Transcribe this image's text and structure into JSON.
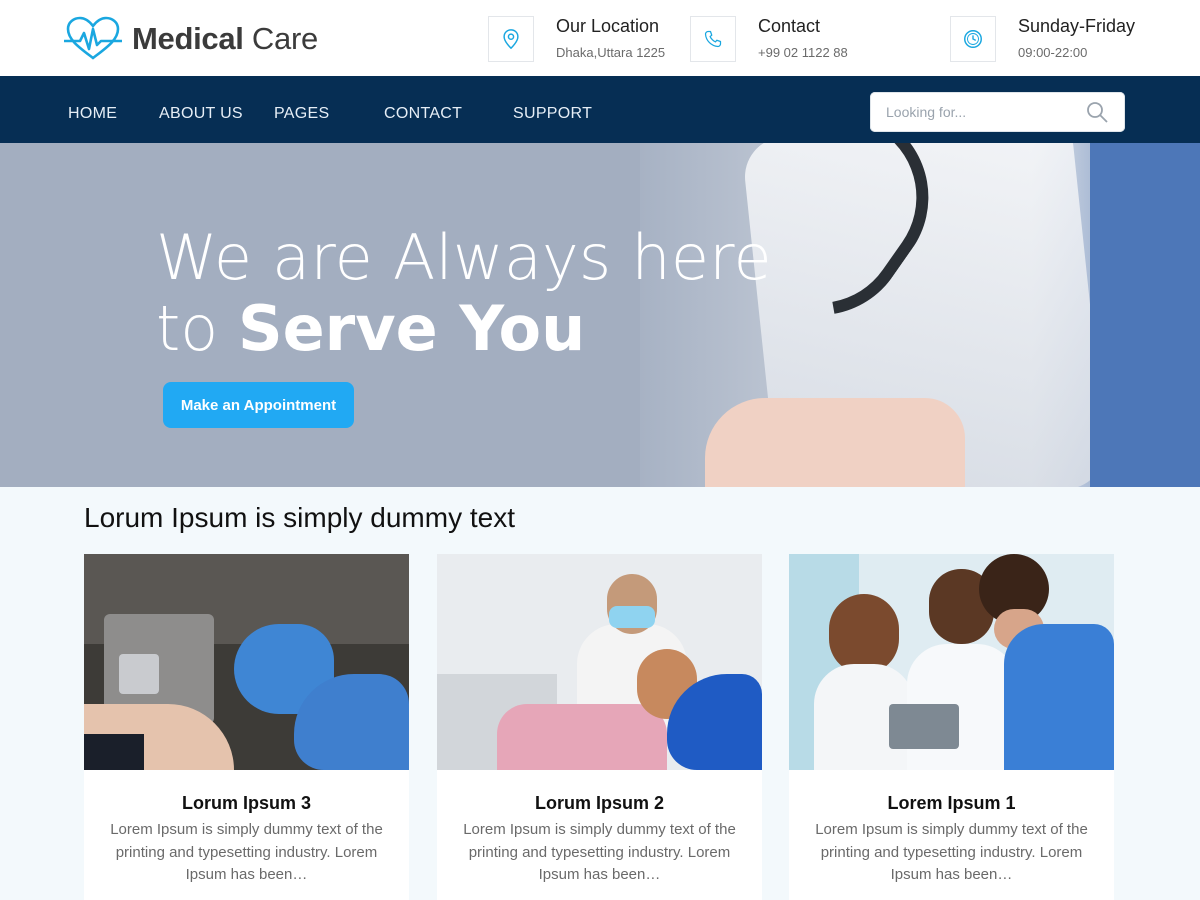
{
  "brand": {
    "name_bold": "Medical",
    "name_light": " Care",
    "logo_color": "#1aa7e0"
  },
  "contact_info": [
    {
      "icon": "location-pin-icon",
      "title": "Our Location",
      "subtitle": "Dhaka,Uttara 1225"
    },
    {
      "icon": "phone-icon",
      "title": "Contact",
      "subtitle": "+99 02 1122 88"
    },
    {
      "icon": "clock-icon",
      "title": "Sunday-Friday",
      "subtitle": "09:00-22:00"
    }
  ],
  "nav": {
    "items": [
      "HOME",
      "ABOUT US",
      "PAGES",
      "CONTACT",
      "SUPPORT"
    ],
    "background": "#062e54"
  },
  "search": {
    "placeholder": "Looking for...",
    "value": "",
    "icon": "search-icon"
  },
  "hero": {
    "line1": "We are Always here",
    "line2_light": "to ",
    "line2_bold": "Serve You",
    "cta": "Make an Appointment",
    "cta_color": "#21a9f3"
  },
  "section": {
    "title": "Lorum Ipsum is simply dummy text",
    "cards": [
      {
        "title": "Lorum Ipsum 3",
        "text": "Lorem Ipsum is simply dummy text of the printing and typesetting industry. Lorem Ipsum has been…"
      },
      {
        "title": "Lorum Ipsum 2",
        "text": "Lorem Ipsum is simply dummy text of the printing and typesetting industry. Lorem Ipsum has been…"
      },
      {
        "title": "Lorem Ipsum 1",
        "text": "Lorem Ipsum is simply dummy text of the printing and typesetting industry. Lorem Ipsum has been…"
      }
    ]
  }
}
